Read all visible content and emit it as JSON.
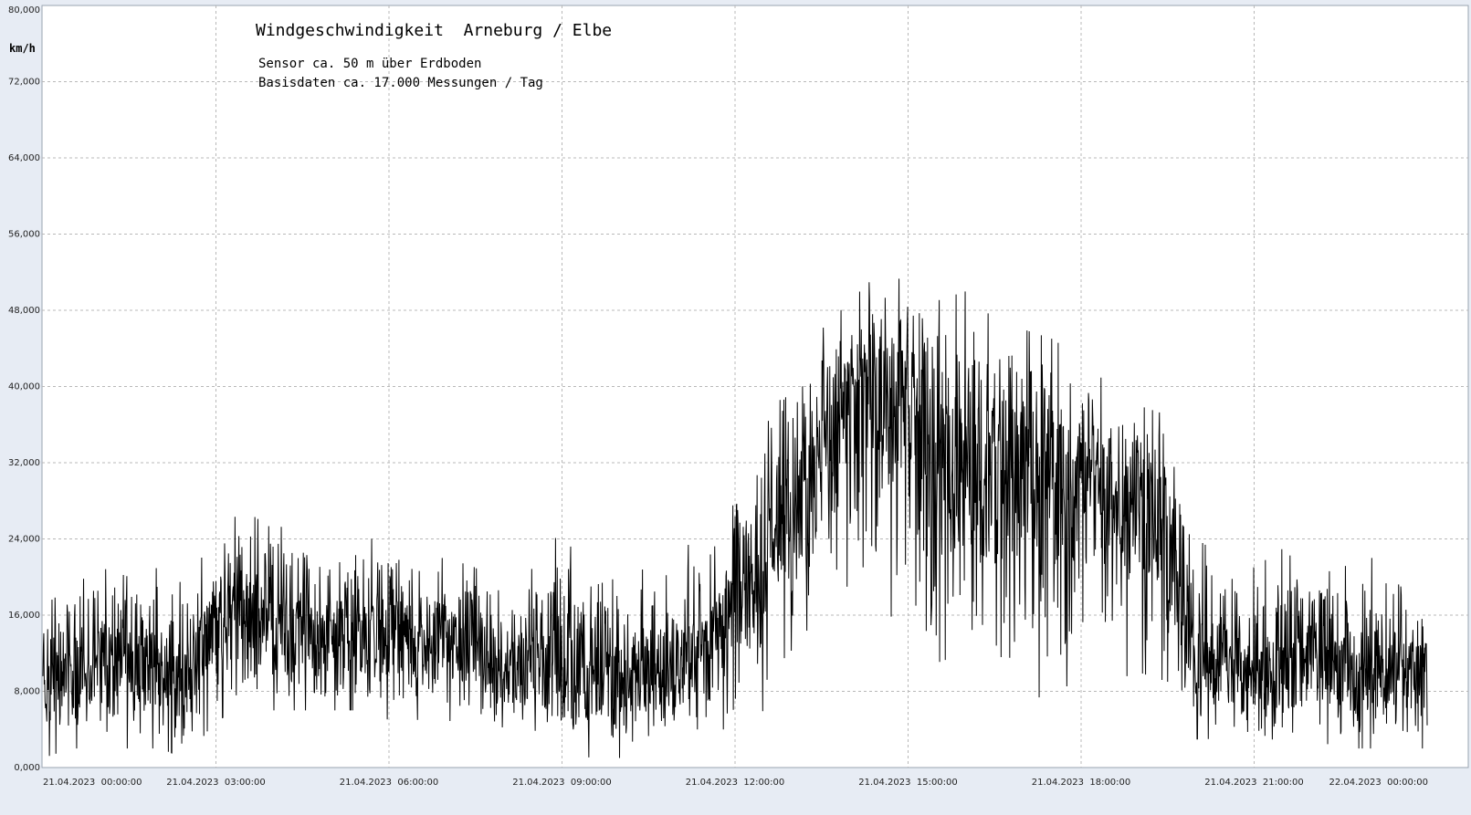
{
  "chart_data": {
    "type": "line",
    "title": "Windgeschwindigkeit  Arneburg / Elbe",
    "subtitle_lines": [
      "Sensor ca. 50 m über Erdboden",
      "Basisdaten ca. 17.000 Messungen / Tag"
    ],
    "ylabel": "km/h",
    "ylim": [
      0,
      80
    ],
    "yticks": [
      0,
      8,
      16,
      24,
      32,
      40,
      48,
      56,
      64,
      72,
      80
    ],
    "ytick_labels": [
      "0,000",
      "8,000",
      "16,000",
      "24,000",
      "32,000",
      "40,000",
      "48,000",
      "56,000",
      "64,000",
      "72,000",
      "80,000"
    ],
    "xlim_hours": [
      0,
      24
    ],
    "xticks_hours": [
      0,
      3,
      6,
      9,
      12,
      15,
      18,
      21,
      24
    ],
    "xtick_labels": [
      "21.04.2023  00:00:00",
      "21.04.2023  03:00:00",
      "21.04.2023  06:00:00",
      "21.04.2023  09:00:00",
      "21.04.2023  12:00:00",
      "21.04.2023  15:00:00",
      "21.04.2023  18:00:00",
      "21.04.2023  21:00:00",
      "22.04.2023  00:00:00"
    ],
    "grid": true,
    "series": [
      {
        "color": "#000000",
        "x_hours": [
          0,
          0.5,
          1,
          1.5,
          2,
          2.5,
          3,
          3.5,
          4,
          4.5,
          5,
          5.5,
          6,
          6.5,
          7,
          7.5,
          8,
          8.5,
          9,
          9.5,
          10,
          10.5,
          11,
          11.5,
          12,
          12.5,
          13,
          13.5,
          14,
          14.5,
          15,
          15.5,
          16,
          16.5,
          17,
          17.5,
          18,
          18.5,
          19,
          19.5,
          20,
          20.5,
          21,
          21.5,
          22,
          22.5,
          23,
          23.5,
          24
        ],
        "mean": [
          7,
          9,
          12,
          11,
          10,
          9,
          16,
          15,
          14,
          14,
          14,
          13,
          14,
          13,
          14,
          12,
          10,
          11,
          10,
          9,
          8,
          10,
          11,
          11,
          16,
          22,
          28,
          32,
          36,
          40,
          36,
          30,
          32,
          30,
          30,
          29,
          29,
          26,
          27,
          24,
          11,
          11,
          9,
          9,
          11,
          10,
          10,
          10,
          10
        ],
        "min": [
          1,
          2,
          2,
          2,
          2,
          1,
          5,
          6,
          6,
          6,
          6,
          6,
          5,
          5,
          5,
          4,
          3,
          4,
          2,
          1,
          1,
          2,
          4,
          4,
          4,
          6,
          9,
          14,
          16,
          20,
          10,
          11,
          12,
          7,
          9,
          6,
          11,
          9,
          10,
          9,
          3,
          3,
          2,
          1,
          3,
          2,
          2,
          2,
          2
        ],
        "max": [
          17,
          19,
          21,
          20,
          21,
          19,
          25,
          27,
          25,
          26,
          24,
          24,
          24,
          22,
          22,
          21,
          18,
          21,
          25,
          19,
          20,
          21,
          23,
          24,
          31,
          41,
          44,
          46,
          49,
          52,
          51,
          49,
          50,
          47,
          46,
          45,
          43,
          40,
          38,
          37,
          24,
          22,
          21,
          23,
          20,
          21,
          22,
          22,
          16
        ]
      }
    ]
  }
}
